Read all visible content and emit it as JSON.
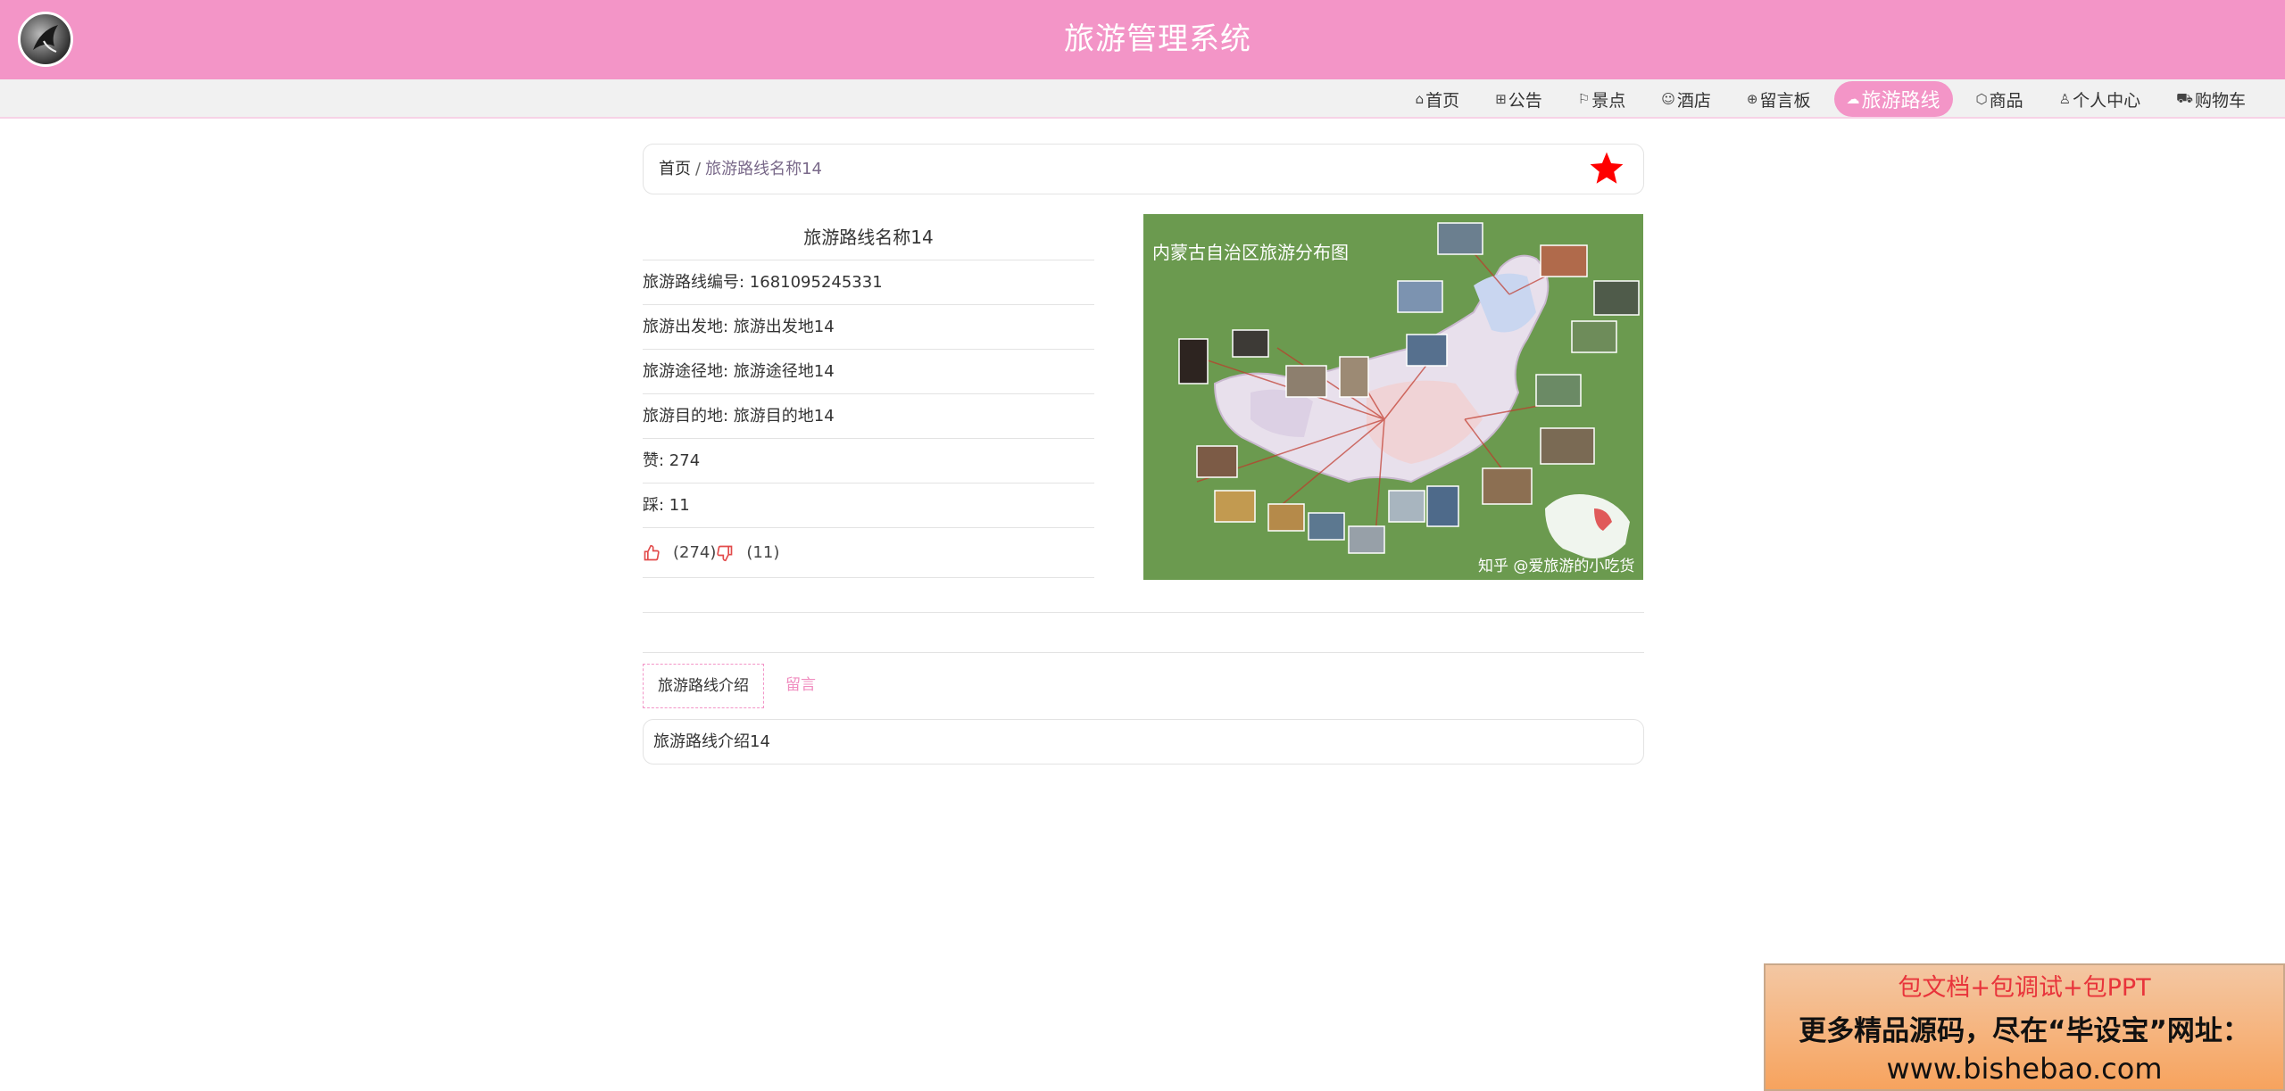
{
  "header": {
    "title": "旅游管理系统"
  },
  "nav": {
    "items": [
      {
        "label": "首页",
        "icon": "home-icon"
      },
      {
        "label": "公告",
        "icon": "gift-icon"
      },
      {
        "label": "景点",
        "icon": "flag-icon"
      },
      {
        "label": "酒店",
        "icon": "face-icon"
      },
      {
        "label": "留言板",
        "icon": "globe-icon"
      },
      {
        "label": "旅游路线",
        "icon": "cloud-icon",
        "active": true
      },
      {
        "label": "商品",
        "icon": "box-icon"
      },
      {
        "label": "个人中心",
        "icon": "user-icon"
      },
      {
        "label": "购物车",
        "icon": "cart-icon"
      }
    ]
  },
  "breadcrumb": {
    "home": "首页",
    "separator": "/",
    "current": "旅游路线名称14"
  },
  "detail": {
    "title": "旅游路线名称14",
    "rows": [
      "旅游路线编号: 1681095245331",
      "旅游出发地: 旅游出发地14",
      "旅游途径地: 旅游途径地14",
      "旅游目的地: 旅游目的地14",
      "赞: 274",
      "踩: 11"
    ],
    "like_count": "(274)",
    "dislike_count": "(11)"
  },
  "map_image": {
    "caption": "内蒙古自治区旅游分布图",
    "watermark": "知乎 @爱旅游的小吃货"
  },
  "tabs": [
    {
      "label": "旅游路线介绍",
      "active": true
    },
    {
      "label": "留言",
      "active": false
    }
  ],
  "intro": {
    "text": "旅游路线介绍14"
  },
  "ad": {
    "line1": "包文档+包调试+包PPT",
    "line2": "更多精品源码，尽在“毕设宝”网址：",
    "line3": "www.bishebao.com"
  },
  "colors": {
    "brand_pink": "#f395c7",
    "star_red": "#ff0000",
    "thumb_red": "#e24b4b"
  }
}
